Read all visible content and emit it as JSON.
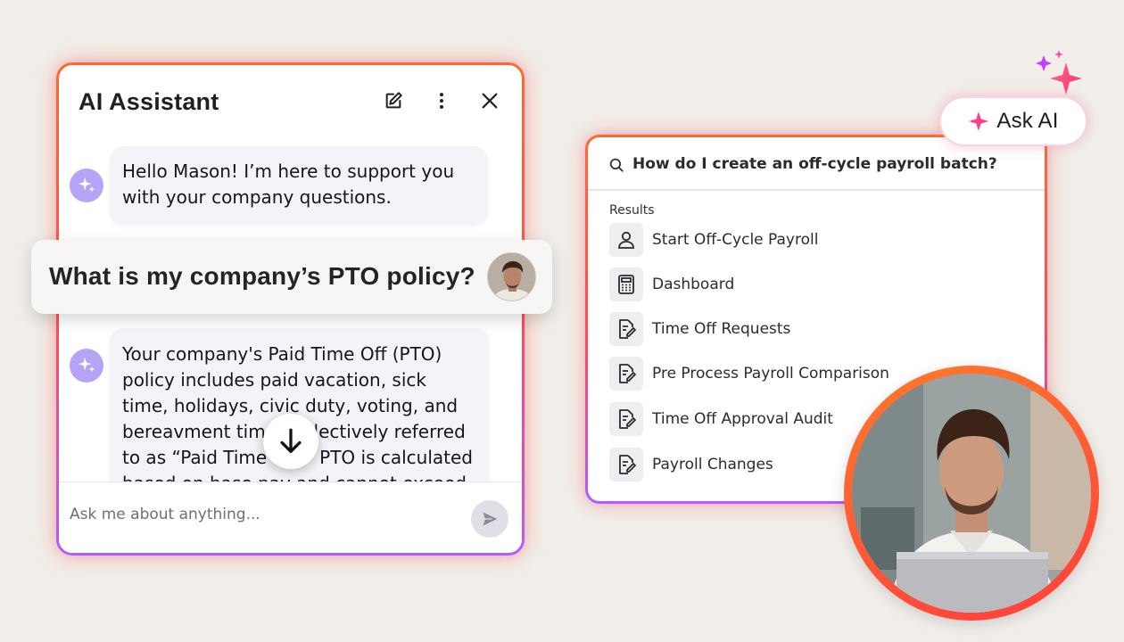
{
  "chat": {
    "title": "AI Assistant",
    "greeting": "Hello Mason! I’m here to support you with your company questions.",
    "answer": "Your company's Paid Time Off (PTO) policy includes paid vacation, sick time, holidays, civic duty, voting, and bereavment time, collectively referred to as “Paid Time Off.” PTO is calculated based on base pay and cannot exceed your average scheduled work",
    "input_placeholder": "Ask me about anything..."
  },
  "question": {
    "text": "What is my company’s PTO policy?"
  },
  "search": {
    "query": "How do I create an off-cycle payroll batch?",
    "results_label": "Results",
    "results": [
      {
        "label": "Start Off-Cycle Payroll",
        "icon": "person-icon"
      },
      {
        "label": "Dashboard",
        "icon": "calculator-icon"
      },
      {
        "label": "Time Off Requests",
        "icon": "document-edit-icon"
      },
      {
        "label": "Pre Process Payroll Comparison",
        "icon": "document-edit-icon"
      },
      {
        "label": "Time Off Approval Audit",
        "icon": "document-edit-icon"
      },
      {
        "label": "Payroll Changes",
        "icon": "document-edit-icon"
      }
    ]
  },
  "ask_ai": {
    "label": "Ask AI"
  },
  "colors": {
    "gradient_orange": "#ff6a2b",
    "gradient_purple": "#b05cff",
    "sparkle_pink": "#ff3d8a",
    "ai_avatar": "#b7a3f5"
  }
}
